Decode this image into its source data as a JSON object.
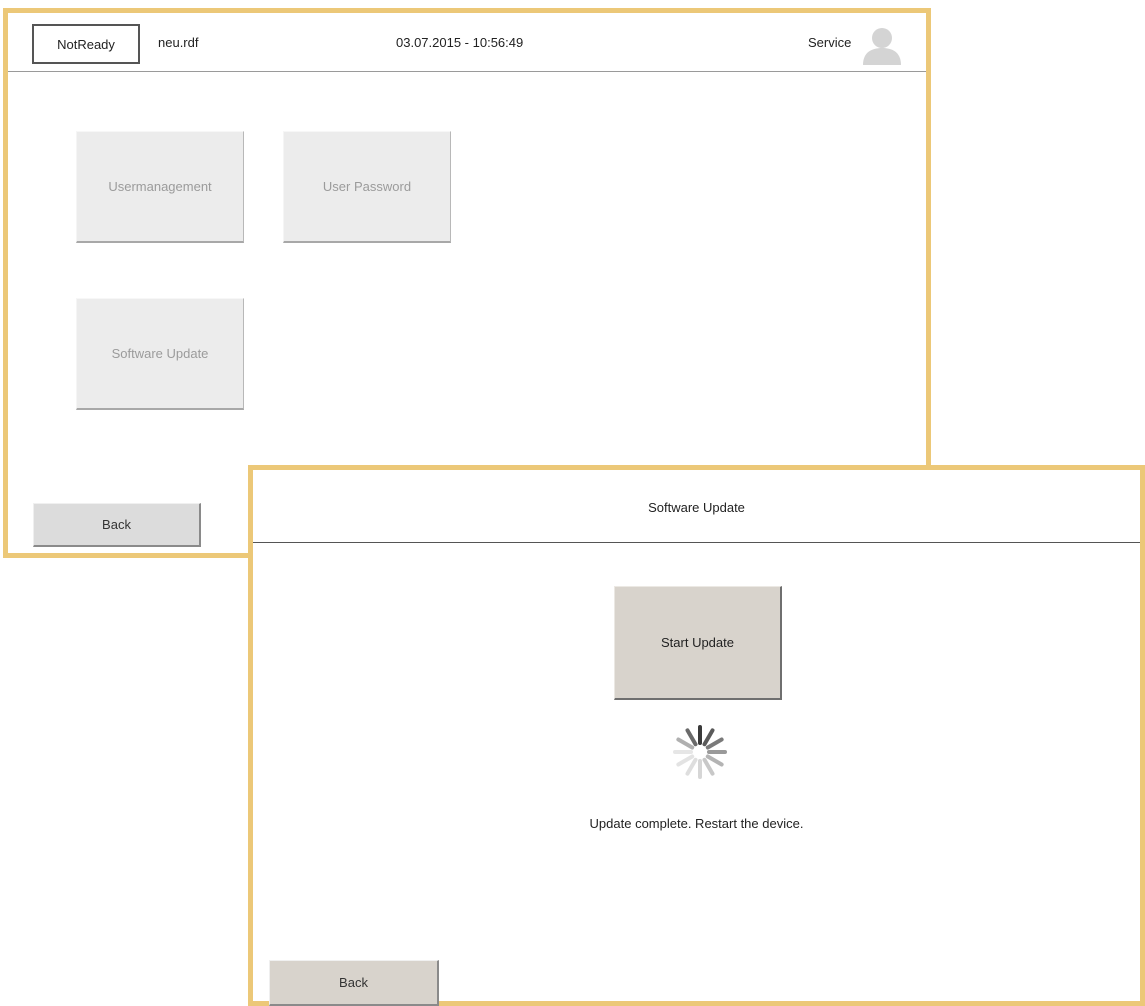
{
  "main_screen": {
    "header": {
      "status": "NotReady",
      "filename": "neu.rdf",
      "datetime": "03.07.2015 - 10:56:49",
      "user_role": "Service"
    },
    "tiles": [
      {
        "label": "Usermanagement",
        "enabled": false
      },
      {
        "label": "User Password",
        "enabled": false
      },
      {
        "label": "Software Update",
        "enabled": false
      }
    ],
    "back_label": "Back"
  },
  "software_update_dialog": {
    "title": "Software Update",
    "start_button_label": "Start Update",
    "status_message": "Update complete. Restart the device.",
    "back_label": "Back"
  },
  "icons": {
    "avatar": "user-avatar-icon",
    "spinner": "loading-spinner-icon"
  },
  "colors": {
    "frame_border": "#ecc878",
    "disabled_tile": "#ececec",
    "dialog_button": "#d8d3cc"
  }
}
